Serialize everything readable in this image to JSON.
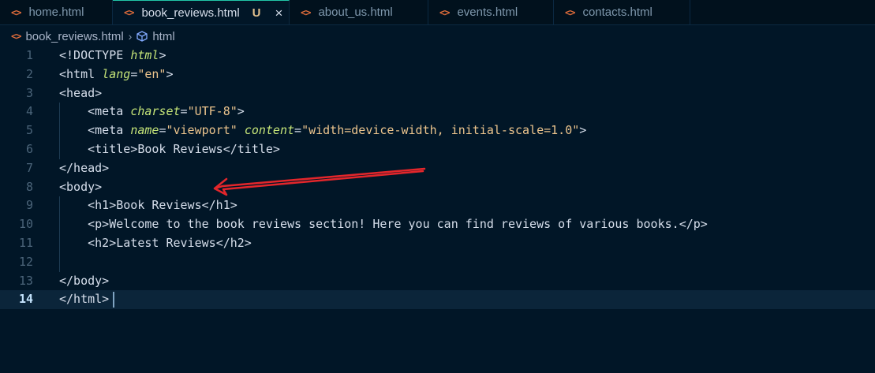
{
  "tabs": [
    {
      "label": "home.html",
      "active": false
    },
    {
      "label": "book_reviews.html",
      "active": true,
      "badge": "U"
    },
    {
      "label": "about_us.html",
      "active": false
    },
    {
      "label": "events.html",
      "active": false
    },
    {
      "label": "contacts.html",
      "active": false
    }
  ],
  "file_icon": "<>",
  "close_icon": "×",
  "breadcrumb": {
    "file": "book_reviews.html",
    "separator": "›",
    "symbol_icon": "cube-icon",
    "symbol": "html"
  },
  "editor": {
    "current_line": 14,
    "lines": [
      {
        "n": "1",
        "tokens": [
          [
            "tag",
            "<!DOCTYPE "
          ],
          [
            "attr",
            "html"
          ],
          [
            "tag",
            ">"
          ]
        ]
      },
      {
        "n": "2",
        "tokens": [
          [
            "tag",
            "<html "
          ],
          [
            "attr",
            "lang"
          ],
          [
            "tag",
            "="
          ],
          [
            "str",
            "\"en\""
          ],
          [
            "tag",
            ">"
          ]
        ]
      },
      {
        "n": "3",
        "tokens": [
          [
            "tag",
            "<head>"
          ]
        ]
      },
      {
        "n": "4",
        "tokens": [
          [
            "tag",
            "    <meta "
          ],
          [
            "attr",
            "charset"
          ],
          [
            "tag",
            "="
          ],
          [
            "str",
            "\"UTF-8\""
          ],
          [
            "tag",
            ">"
          ]
        ]
      },
      {
        "n": "5",
        "tokens": [
          [
            "tag",
            "    <meta "
          ],
          [
            "attr",
            "name"
          ],
          [
            "tag",
            "="
          ],
          [
            "str",
            "\"viewport\""
          ],
          [
            "tag",
            " "
          ],
          [
            "attr",
            "content"
          ],
          [
            "tag",
            "="
          ],
          [
            "str",
            "\"width=device-width, initial-scale=1.0\""
          ],
          [
            "tag",
            ">"
          ]
        ]
      },
      {
        "n": "6",
        "tokens": [
          [
            "tag",
            "    <title>"
          ],
          [
            "txt",
            "Book Reviews"
          ],
          [
            "tag",
            "</title>"
          ]
        ]
      },
      {
        "n": "7",
        "tokens": [
          [
            "tag",
            "</head>"
          ]
        ]
      },
      {
        "n": "8",
        "tokens": [
          [
            "tag",
            "<body>"
          ]
        ]
      },
      {
        "n": "9",
        "tokens": [
          [
            "tag",
            "    <h1>"
          ],
          [
            "txt",
            "Book Reviews"
          ],
          [
            "tag",
            "</h1>"
          ]
        ]
      },
      {
        "n": "10",
        "tokens": [
          [
            "tag",
            "    <p>"
          ],
          [
            "txt",
            "Welcome to the book reviews section! Here you can find reviews of various books."
          ],
          [
            "tag",
            "</p>"
          ]
        ]
      },
      {
        "n": "11",
        "tokens": [
          [
            "tag",
            "    <h2>"
          ],
          [
            "txt",
            "Latest Reviews"
          ],
          [
            "tag",
            "</h2>"
          ]
        ]
      },
      {
        "n": "12",
        "tokens": []
      },
      {
        "n": "13",
        "tokens": [
          [
            "tag",
            "</body>"
          ]
        ]
      },
      {
        "n": "14",
        "tokens": [
          [
            "tag",
            "</html>"
          ]
        ]
      }
    ]
  },
  "colors": {
    "background": "#011627",
    "tag": "#d6deeb",
    "attribute": "#c5e478",
    "string": "#ecc48d",
    "annotation_arrow": "#e3262b"
  }
}
